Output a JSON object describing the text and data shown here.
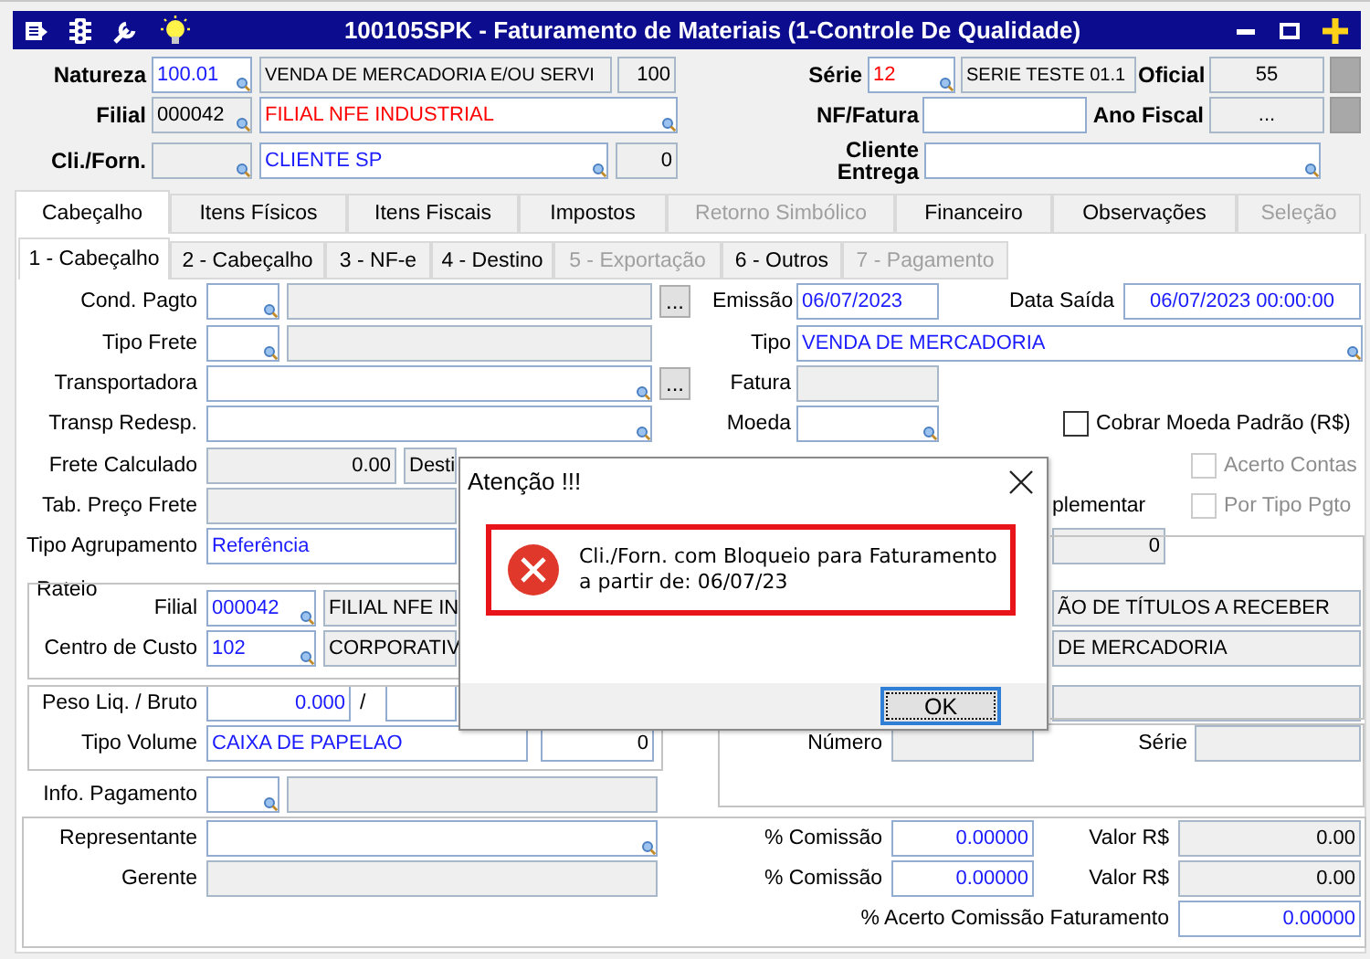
{
  "window": {
    "title": "100105SPK - Faturamento de Materiais (1-Controle De Qualidade)"
  },
  "header_rows": [
    {
      "items": [
        {
          "kind": "label",
          "text": "Natureza"
        },
        {
          "kind": "field",
          "value": "100.01",
          "color": "#1a1aff",
          "readonly": false,
          "lookup": true
        },
        {
          "kind": "field",
          "value": "VENDA DE MERCADORIA E/OU SERVI",
          "readonly": true,
          "lookup": false
        },
        {
          "kind": "field",
          "value": "100",
          "readonly": true,
          "lookup": false
        },
        {
          "kind": "label",
          "text": "Série"
        },
        {
          "kind": "field",
          "value": "12",
          "color": "#ff0000",
          "readonly": false,
          "lookup": true
        },
        {
          "kind": "field",
          "value": "SERIE TESTE 01.1",
          "readonly": true,
          "lookup": false
        },
        {
          "kind": "label",
          "text": "Oficial"
        },
        {
          "kind": "field",
          "value": "55",
          "readonly": true,
          "lookup": false
        },
        {
          "kind": "tool"
        }
      ]
    },
    {
      "items": [
        {
          "kind": "label",
          "text": "Filial"
        },
        {
          "kind": "field",
          "value": "000042",
          "readonly": true,
          "lookup": true
        },
        {
          "kind": "field",
          "value": "FILIAL NFE INDUSTRIAL",
          "color": "#ff0000",
          "readonly": false,
          "lookup": true
        },
        {
          "kind": "label",
          "text": "NF/Fatura"
        },
        {
          "kind": "field",
          "readonly": false,
          "lookup": false
        },
        {
          "kind": "label",
          "text": "Ano Fiscal"
        },
        {
          "kind": "field",
          "value": "...",
          "readonly": true,
          "lookup": false
        },
        {
          "kind": "tool"
        }
      ]
    },
    {
      "items": [
        {
          "kind": "label",
          "text": "Cli./Forn."
        },
        {
          "kind": "field",
          "readonly": true,
          "lookup": true
        },
        {
          "kind": "field",
          "value": "CLIENTE SP",
          "color": "#1a1aff",
          "readonly": false,
          "lookup": true
        },
        {
          "kind": "field",
          "value": "0",
          "readonly": true,
          "lookup": false
        },
        {
          "kind": "label",
          "text": "Cliente Entrega"
        },
        {
          "kind": "field",
          "readonly": false,
          "lookup": true
        }
      ]
    }
  ],
  "tabs": [
    {
      "label": "Cabeçalho",
      "selected": true,
      "disabled": false
    },
    {
      "label": "Itens Físicos",
      "selected": false,
      "disabled": false
    },
    {
      "label": "Itens Fiscais",
      "selected": false,
      "disabled": false
    },
    {
      "label": "Impostos",
      "selected": false,
      "disabled": false
    },
    {
      "label": "Retorno Simbólico",
      "selected": false,
      "disabled": true
    },
    {
      "label": "Financeiro",
      "selected": false,
      "disabled": false
    },
    {
      "label": "Observações",
      "selected": false,
      "disabled": false
    },
    {
      "label": "Seleção",
      "selected": false,
      "disabled": true
    }
  ],
  "subtabs": [
    {
      "label": "1 - Cabeçalho",
      "selected": true,
      "disabled": false
    },
    {
      "label": "2 - Cabeçalho",
      "selected": false,
      "disabled": false
    },
    {
      "label": "3 - NF-e",
      "selected": false,
      "disabled": false
    },
    {
      "label": "4 - Destino",
      "selected": false,
      "disabled": false
    },
    {
      "label": "5 - Exportação",
      "selected": false,
      "disabled": true
    },
    {
      "label": "6 - Outros",
      "selected": false,
      "disabled": false
    },
    {
      "label": "7 - Pagamento",
      "selected": false,
      "disabled": true
    }
  ],
  "form_rows": [
    {
      "items": [
        {
          "kind": "label",
          "text": "Cond. Pagto"
        },
        {
          "kind": "field",
          "readonly": false,
          "lookup": true
        },
        {
          "kind": "field",
          "readonly": true,
          "lookup": false
        },
        {
          "kind": "button",
          "text": "..."
        },
        {
          "kind": "label",
          "text": "Emissão"
        },
        {
          "kind": "field",
          "value": "06/07/2023",
          "color": "#1a1aff",
          "readonly": false,
          "lookup": false
        },
        {
          "kind": "label",
          "text": "Data Saída"
        },
        {
          "kind": "field",
          "value": "06/07/2023 00:00:00",
          "color": "#1a1aff",
          "readonly": false,
          "lookup": false
        }
      ]
    },
    {
      "items": [
        {
          "kind": "label",
          "text": "Tipo Frete"
        },
        {
          "kind": "field",
          "readonly": false,
          "lookup": true
        },
        {
          "kind": "field",
          "readonly": true,
          "lookup": false
        },
        {
          "kind": "label",
          "text": "Tipo"
        },
        {
          "kind": "field",
          "value": "VENDA DE MERCADORIA",
          "color": "#1a1aff",
          "readonly": false,
          "lookup": true
        }
      ]
    },
    {
      "items": [
        {
          "kind": "label",
          "text": "Transportadora"
        },
        {
          "kind": "field",
          "readonly": false,
          "lookup": true
        },
        {
          "kind": "button",
          "text": "..."
        },
        {
          "kind": "label",
          "text": "Fatura"
        },
        {
          "kind": "field",
          "readonly": true,
          "lookup": false
        }
      ]
    },
    {
      "items": [
        {
          "kind": "label",
          "text": "Transp Redesp."
        },
        {
          "kind": "field",
          "readonly": false,
          "lookup": true
        },
        {
          "kind": "label",
          "text": "Moeda"
        },
        {
          "kind": "field",
          "readonly": false,
          "lookup": true
        },
        {
          "kind": "checkbox",
          "label": "Cobrar Moeda Padrão (R$)",
          "checked": false,
          "disabled": false
        }
      ]
    },
    {
      "items": [
        {
          "kind": "label",
          "text": "Frete Calculado"
        },
        {
          "kind": "field",
          "value": "0.00",
          "readonly": true,
          "lookup": false
        },
        {
          "kind": "field",
          "value": "Desti",
          "readonly": true,
          "lookup": false
        },
        {
          "kind": "checkbox",
          "label": "Acerto Contas",
          "checked": false,
          "disabled": true
        }
      ]
    },
    {
      "items": [
        {
          "kind": "label",
          "text": "Tab. Preço Frete"
        },
        {
          "kind": "field",
          "readonly": true,
          "lookup": false
        },
        {
          "kind": "text",
          "text": "plementar"
        },
        {
          "kind": "checkbox",
          "label": "Por Tipo Pgto",
          "checked": false,
          "disabled": true
        }
      ]
    },
    {
      "items": [
        {
          "kind": "label",
          "text": "Tipo Agrupamento"
        },
        {
          "kind": "field",
          "value": "Referência",
          "color": "#1a1aff",
          "readonly": false,
          "lookup": false
        },
        {
          "kind": "field",
          "value": "0",
          "readonly": true,
          "lookup": false
        }
      ]
    },
    {
      "items": [
        {
          "kind": "text",
          "text": "Rateio"
        },
        {
          "kind": "label",
          "text": "Filial"
        },
        {
          "kind": "field",
          "value": "000042",
          "color": "#1a1aff",
          "readonly": false,
          "lookup": true
        },
        {
          "kind": "field",
          "value": "FILIAL NFE IN",
          "readonly": true,
          "lookup": false
        },
        {
          "kind": "field",
          "value": "ÃO DE TÍTULOS A RECEBER",
          "readonly": true,
          "lookup": false
        }
      ]
    },
    {
      "items": [
        {
          "kind": "label",
          "text": "Centro de Custo"
        },
        {
          "kind": "field",
          "value": "102",
          "color": "#1a1aff",
          "readonly": false,
          "lookup": true
        },
        {
          "kind": "field",
          "value": "CORPORATIV",
          "readonly": true,
          "lookup": false
        },
        {
          "kind": "field",
          "value": "DE MERCADORIA",
          "readonly": true,
          "lookup": false
        }
      ]
    },
    {
      "items": [
        {
          "kind": "label",
          "text": "Peso Liq. / Bruto"
        },
        {
          "kind": "field",
          "value": "0.000",
          "color": "#1a1aff",
          "readonly": false,
          "lookup": false
        },
        {
          "kind": "text",
          "text": "/"
        },
        {
          "kind": "field",
          "readonly": false,
          "lookup": false
        },
        {
          "kind": "field",
          "readonly": true,
          "lookup": false
        }
      ]
    },
    {
      "items": [
        {
          "kind": "label",
          "text": "Tipo Volume"
        },
        {
          "kind": "field",
          "value": "CAIXA DE PAPELAO",
          "color": "#1a1aff",
          "readonly": false,
          "lookup": false
        },
        {
          "kind": "field",
          "value": "0",
          "readonly": false,
          "lookup": false
        },
        {
          "kind": "label",
          "text": "Número"
        },
        {
          "kind": "field",
          "readonly": true,
          "lookup": false
        },
        {
          "kind": "label",
          "text": "Série"
        },
        {
          "kind": "field",
          "readonly": true,
          "lookup": false
        }
      ]
    },
    {
      "items": [
        {
          "kind": "label",
          "text": "Info. Pagamento"
        },
        {
          "kind": "field",
          "readonly": false,
          "lookup": true
        },
        {
          "kind": "field",
          "readonly": true,
          "lookup": false
        }
      ]
    },
    {
      "items": [
        {
          "kind": "label",
          "text": "Representante"
        },
        {
          "kind": "field",
          "readonly": false,
          "lookup": true
        },
        {
          "kind": "label",
          "text": "% Comissão"
        },
        {
          "kind": "field",
          "value": "0.00000",
          "color": "#1a1aff",
          "readonly": false,
          "lookup": false
        },
        {
          "kind": "label",
          "text": "Valor R$"
        },
        {
          "kind": "field",
          "value": "0.00",
          "readonly": true,
          "lookup": false
        }
      ]
    },
    {
      "items": [
        {
          "kind": "label",
          "text": "Gerente"
        },
        {
          "kind": "field",
          "readonly": true,
          "lookup": false
        },
        {
          "kind": "label",
          "text": "% Comissão"
        },
        {
          "kind": "field",
          "value": "0.00000",
          "color": "#1a1aff",
          "readonly": false,
          "lookup": false
        },
        {
          "kind": "label",
          "text": "Valor R$"
        },
        {
          "kind": "field",
          "value": "0.00",
          "readonly": true,
          "lookup": false
        }
      ]
    },
    {
      "items": [
        {
          "kind": "label",
          "text": "% Acerto Comissão Faturamento"
        },
        {
          "kind": "field",
          "value": "0.00000",
          "color": "#1a1aff",
          "readonly": false,
          "lookup": false
        }
      ]
    }
  ],
  "dialog": {
    "title": "Atenção !!!",
    "message": "Cli./Forn. com Bloqueio para Faturamento\na partir de: 06/07/23",
    "button": "OK"
  }
}
